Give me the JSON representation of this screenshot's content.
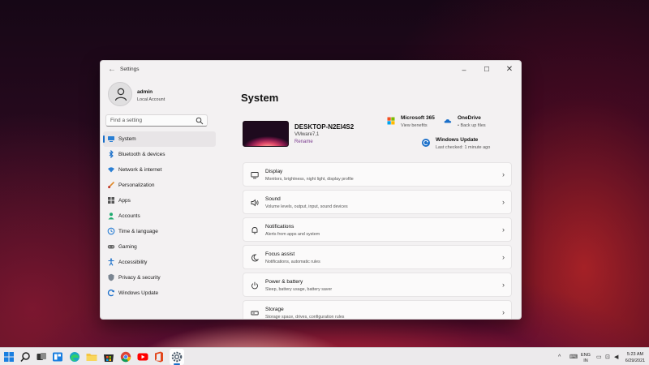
{
  "window": {
    "title": "Settings",
    "back_icon": "back-arrow-icon",
    "controls": {
      "minimize": "minimize-icon",
      "maximize": "maximize-icon",
      "close": "close-icon"
    }
  },
  "user": {
    "name": "admin",
    "subtitle": "Local Account"
  },
  "search": {
    "placeholder": "Find a setting"
  },
  "sidebar": {
    "items": [
      {
        "label": "System",
        "icon": "system-icon",
        "active": true
      },
      {
        "label": "Bluetooth & devices",
        "icon": "bluetooth-icon"
      },
      {
        "label": "Network & internet",
        "icon": "wifi-icon"
      },
      {
        "label": "Personalization",
        "icon": "brush-icon"
      },
      {
        "label": "Apps",
        "icon": "apps-icon"
      },
      {
        "label": "Accounts",
        "icon": "accounts-icon"
      },
      {
        "label": "Time & language",
        "icon": "globe-clock-icon"
      },
      {
        "label": "Gaming",
        "icon": "gamepad-icon"
      },
      {
        "label": "Accessibility",
        "icon": "accessibility-icon"
      },
      {
        "label": "Privacy & security",
        "icon": "shield-icon"
      },
      {
        "label": "Windows Update",
        "icon": "windows-update-icon"
      }
    ]
  },
  "main": {
    "title": "System",
    "device": {
      "name": "DESKTOP-N2EI4S2",
      "model": "VMware7,1",
      "rename": "Rename"
    },
    "services": {
      "microsoft365": {
        "title": "Microsoft 365",
        "subtitle": "View benefits"
      },
      "onedrive": {
        "title": "OneDrive",
        "subtitle": "• Back up files"
      },
      "windows_update": {
        "title": "Windows Update",
        "subtitle": "Last checked: 1 minute ago"
      }
    },
    "cards": [
      {
        "title": "Display",
        "subtitle": "Monitors, brightness, night light, display profile",
        "icon": "display-icon"
      },
      {
        "title": "Sound",
        "subtitle": "Volume levels, output, input, sound devices",
        "icon": "speaker-icon"
      },
      {
        "title": "Notifications",
        "subtitle": "Alerts from apps and system",
        "icon": "bell-icon"
      },
      {
        "title": "Focus assist",
        "subtitle": "Notifications, automatic rules",
        "icon": "moon-icon"
      },
      {
        "title": "Power & battery",
        "subtitle": "Sleep, battery usage, battery saver",
        "icon": "power-icon"
      },
      {
        "title": "Storage",
        "subtitle": "Storage space, drives, configuration rules",
        "icon": "storage-icon"
      }
    ]
  },
  "taskbar": {
    "apps": [
      "start-icon",
      "search-icon",
      "task-view-icon",
      "widgets-icon",
      "edge-icon",
      "file-explorer-icon",
      "store-icon",
      "chrome-icon",
      "youtube-icon",
      "office-icon",
      "settings-icon"
    ],
    "tray": {
      "language": "ENG",
      "region": "IN",
      "time": "5:23 AM",
      "date": "6/29/2021"
    }
  },
  "colors": {
    "accent": "#1a6fc9",
    "rename_link": "#7a3b8f",
    "window_bg": "#f3f1f2"
  }
}
